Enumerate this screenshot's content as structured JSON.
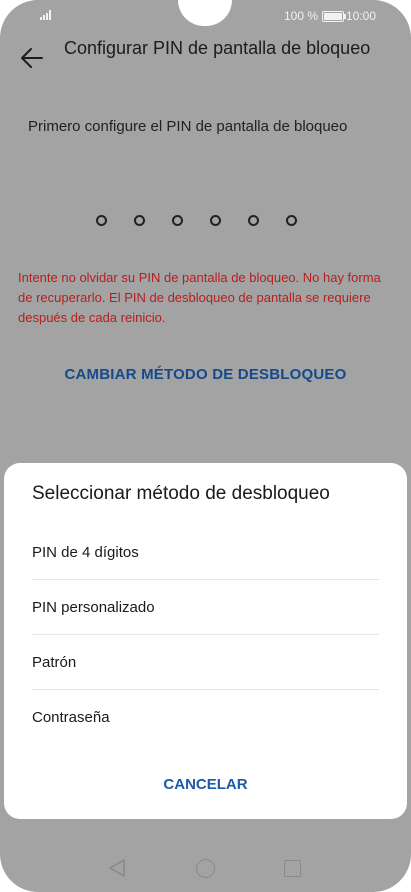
{
  "status": {
    "battery_text": "100 %",
    "time": "10:00",
    "icons": [
      "signal-icon",
      "battery-icon"
    ]
  },
  "header": {
    "title": "Configurar PIN de pantalla de bloqueo",
    "back_icon": "arrow-left-icon"
  },
  "instruction": "Primero configure el PIN de pantalla de bloqueo",
  "pin_length": 6,
  "warning": "Intente no olvidar su PIN de pantalla de bloqueo. No hay forma de recuperarlo. El PIN de desbloqueo de pantalla se requiere después de cada reinicio.",
  "change_method_label": "CAMBIAR MÉTODO DE DESBLOQUEO",
  "sheet": {
    "title": "Seleccionar método de desbloqueo",
    "options": [
      {
        "label": "PIN de 4 dígitos"
      },
      {
        "label": "PIN personalizado"
      },
      {
        "label": "Patrón"
      },
      {
        "label": "Contraseña"
      }
    ],
    "cancel_label": "CANCELAR"
  },
  "navbar": {
    "icons": [
      "nav-back-icon",
      "nav-home-icon",
      "nav-recent-icon"
    ]
  },
  "colors": {
    "background_dim": "#a3a3a3",
    "warning": "#b81e1e",
    "accent": "#1e5aa8"
  }
}
